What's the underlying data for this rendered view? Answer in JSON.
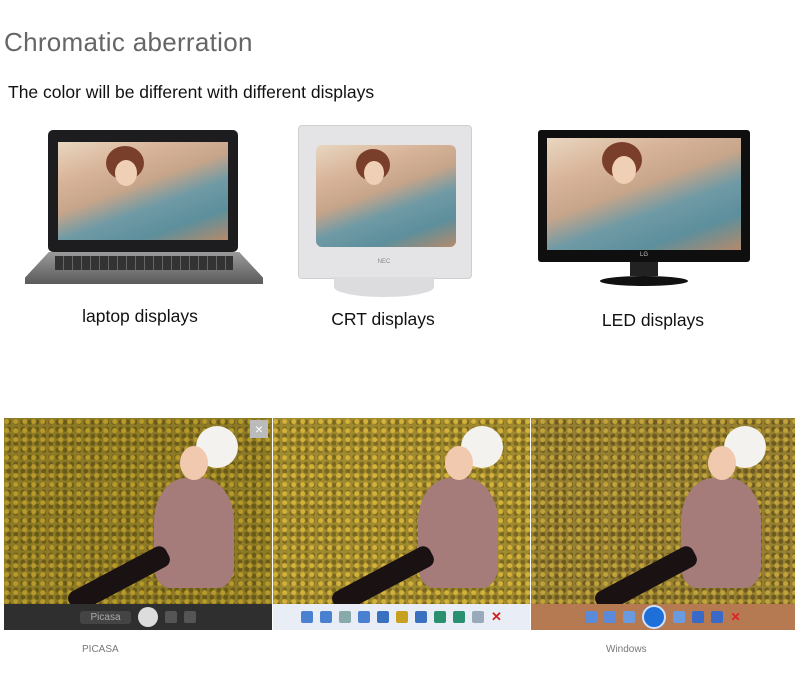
{
  "header": {
    "title": "Chromatic aberration",
    "subtitle": "The color will be different with different displays"
  },
  "displays": [
    {
      "label": "laptop displays",
      "icon": "laptop-icon"
    },
    {
      "label": "CRT displays",
      "icon": "crt-monitor-icon",
      "brand": "NEC"
    },
    {
      "label": "LED displays",
      "icon": "led-monitor-icon",
      "brand": "LG"
    }
  ],
  "viewers": [
    {
      "label": "PICASA",
      "toolbar_text": "Picasa",
      "toolbar_color": "#2f2f2f"
    },
    {
      "label": "",
      "toolbar_color": "#e9eef6"
    },
    {
      "label": "Windows",
      "toolbar_color": "#b57a52"
    }
  ]
}
